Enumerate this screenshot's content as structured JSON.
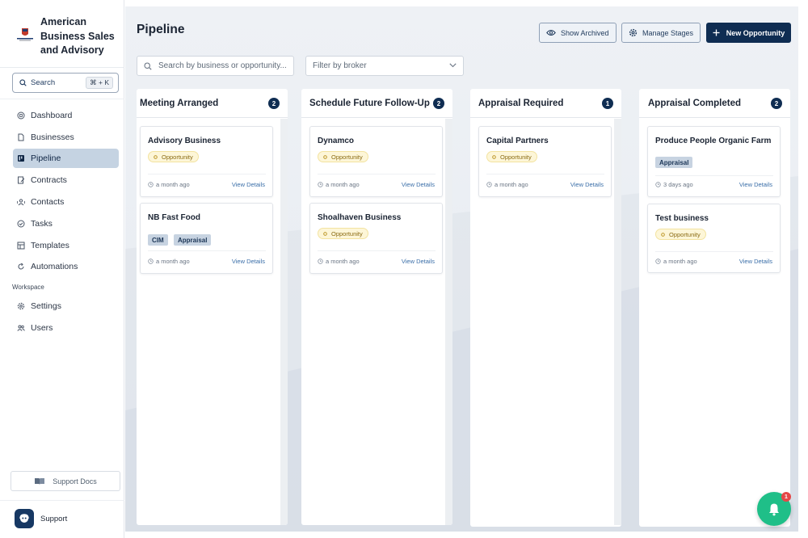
{
  "brand": {
    "name": "American Business Sales and Advisory"
  },
  "sidebar": {
    "search_label": "Search",
    "search_shortcut": "⌘ + K",
    "items": [
      {
        "label": "Dashboard",
        "icon": "home-icon"
      },
      {
        "label": "Businesses",
        "icon": "file-icon"
      },
      {
        "label": "Pipeline",
        "icon": "pipeline-icon",
        "active": true
      },
      {
        "label": "Contracts",
        "icon": "contract-icon"
      },
      {
        "label": "Contacts",
        "icon": "contacts-icon"
      },
      {
        "label": "Tasks",
        "icon": "check-circle-icon"
      },
      {
        "label": "Templates",
        "icon": "template-icon"
      },
      {
        "label": "Automations",
        "icon": "automation-icon"
      }
    ],
    "workspace_label": "Workspace",
    "workspace_items": [
      {
        "label": "Settings",
        "icon": "gear-icon"
      },
      {
        "label": "Users",
        "icon": "users-icon"
      }
    ],
    "support_docs_label": "Support Docs",
    "support_label": "Support"
  },
  "header": {
    "title": "Pipeline",
    "show_archived_label": "Show Archived",
    "manage_stages_label": "Manage Stages",
    "new_opportunity_label": "New Opportunity"
  },
  "filters": {
    "search_placeholder": "Search by business or opportunity...",
    "broker_placeholder": "Filter by broker"
  },
  "columns": [
    {
      "title": "Meeting Arranged",
      "count": "2",
      "cards": [
        {
          "title": "Advisory Business",
          "badge": "Opportunity",
          "tags": [],
          "time": "a month ago",
          "link": "View Details"
        },
        {
          "title": "NB Fast Food",
          "badge": "",
          "tags": [
            "CIM",
            "Appraisal"
          ],
          "time": "a month ago",
          "link": "View Details"
        }
      ]
    },
    {
      "title": "Schedule Future Follow-Up",
      "count": "2",
      "cards": [
        {
          "title": "Dynamco",
          "badge": "Opportunity",
          "tags": [],
          "time": "a month ago",
          "link": "View Details"
        },
        {
          "title": "Shoalhaven Business",
          "badge": "Opportunity",
          "tags": [],
          "time": "a month ago",
          "link": "View Details"
        }
      ]
    },
    {
      "title": "Appraisal Required",
      "count": "1",
      "cards": [
        {
          "title": "Capital Partners",
          "badge": "Opportunity",
          "tags": [],
          "time": "a month ago",
          "link": "View Details"
        }
      ]
    },
    {
      "title": "Appraisal Completed",
      "count": "2",
      "cards": [
        {
          "title": "Produce People Organic Farm",
          "badge": "",
          "tags": [
            "Appraisal"
          ],
          "time": "3 days ago",
          "link": "View Details"
        },
        {
          "title": "Test business",
          "badge": "Opportunity",
          "tags": [],
          "time": "a month ago",
          "link": "View Details"
        }
      ]
    }
  ],
  "notifications": {
    "count": "1",
    "icon": "bell-icon"
  },
  "colors": {
    "primary": "#0f2d52",
    "active_nav": "#c5d3e2",
    "badge_opportunity": "#fdf6d8",
    "notification": "#1fbf88"
  }
}
